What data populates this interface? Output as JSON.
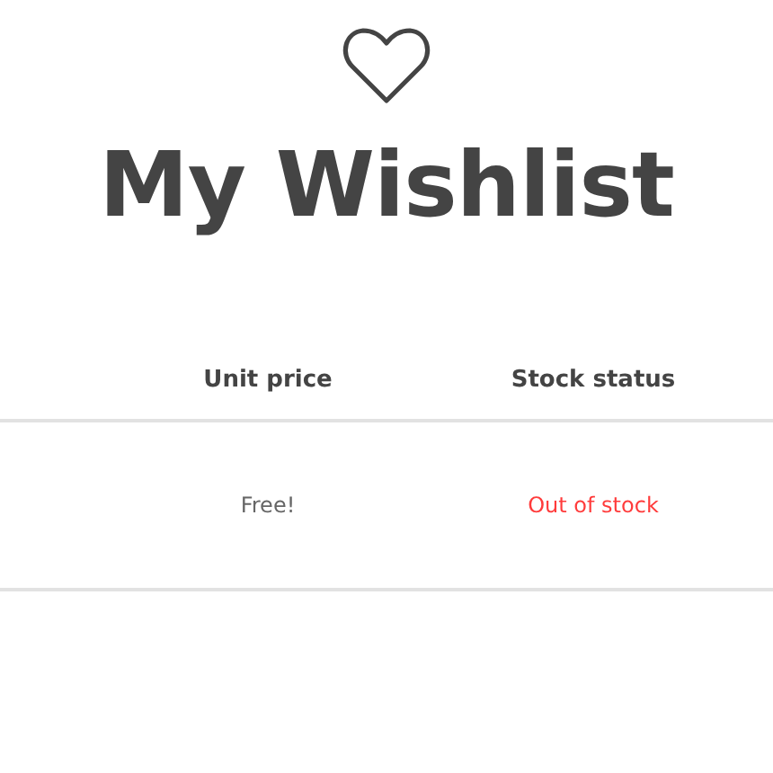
{
  "title": "My Wishlist",
  "table": {
    "columns": [
      "Unit price",
      "Stock status"
    ],
    "rows": [
      {
        "unit_price": "Free!",
        "stock_status": "Out of stock",
        "in_stock": false
      }
    ]
  }
}
